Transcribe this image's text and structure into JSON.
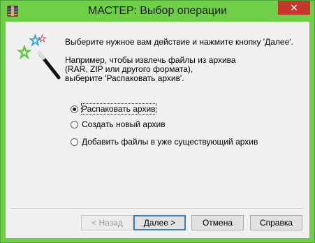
{
  "window": {
    "title": "МАСТЕР:   Выбор операции",
    "close_glyph": "✕"
  },
  "instructions": {
    "line1": "Выберите нужное вам действие и нажмите кнопку 'Далее'.",
    "example": "Например, чтобы извлечь файлы из архива\n(RAR, ZIP или другого формата),\nвыберите 'Распаковать архив'."
  },
  "options": [
    {
      "label": "Распаковать архив",
      "checked": true
    },
    {
      "label": "Создать новый архив",
      "checked": false
    },
    {
      "label": "Добавить файлы в уже существующий архив",
      "checked": false
    }
  ],
  "buttons": {
    "back": "< Назад",
    "next": "Далее >",
    "cancel": "Отмена",
    "help": "Справка"
  },
  "colors": {
    "titlebar": "#6fcf46",
    "close": "#c7362b",
    "client": "#f0f0f0"
  },
  "icons": {
    "app": "winrar-icon",
    "wizard": "magic-wand-icon"
  }
}
